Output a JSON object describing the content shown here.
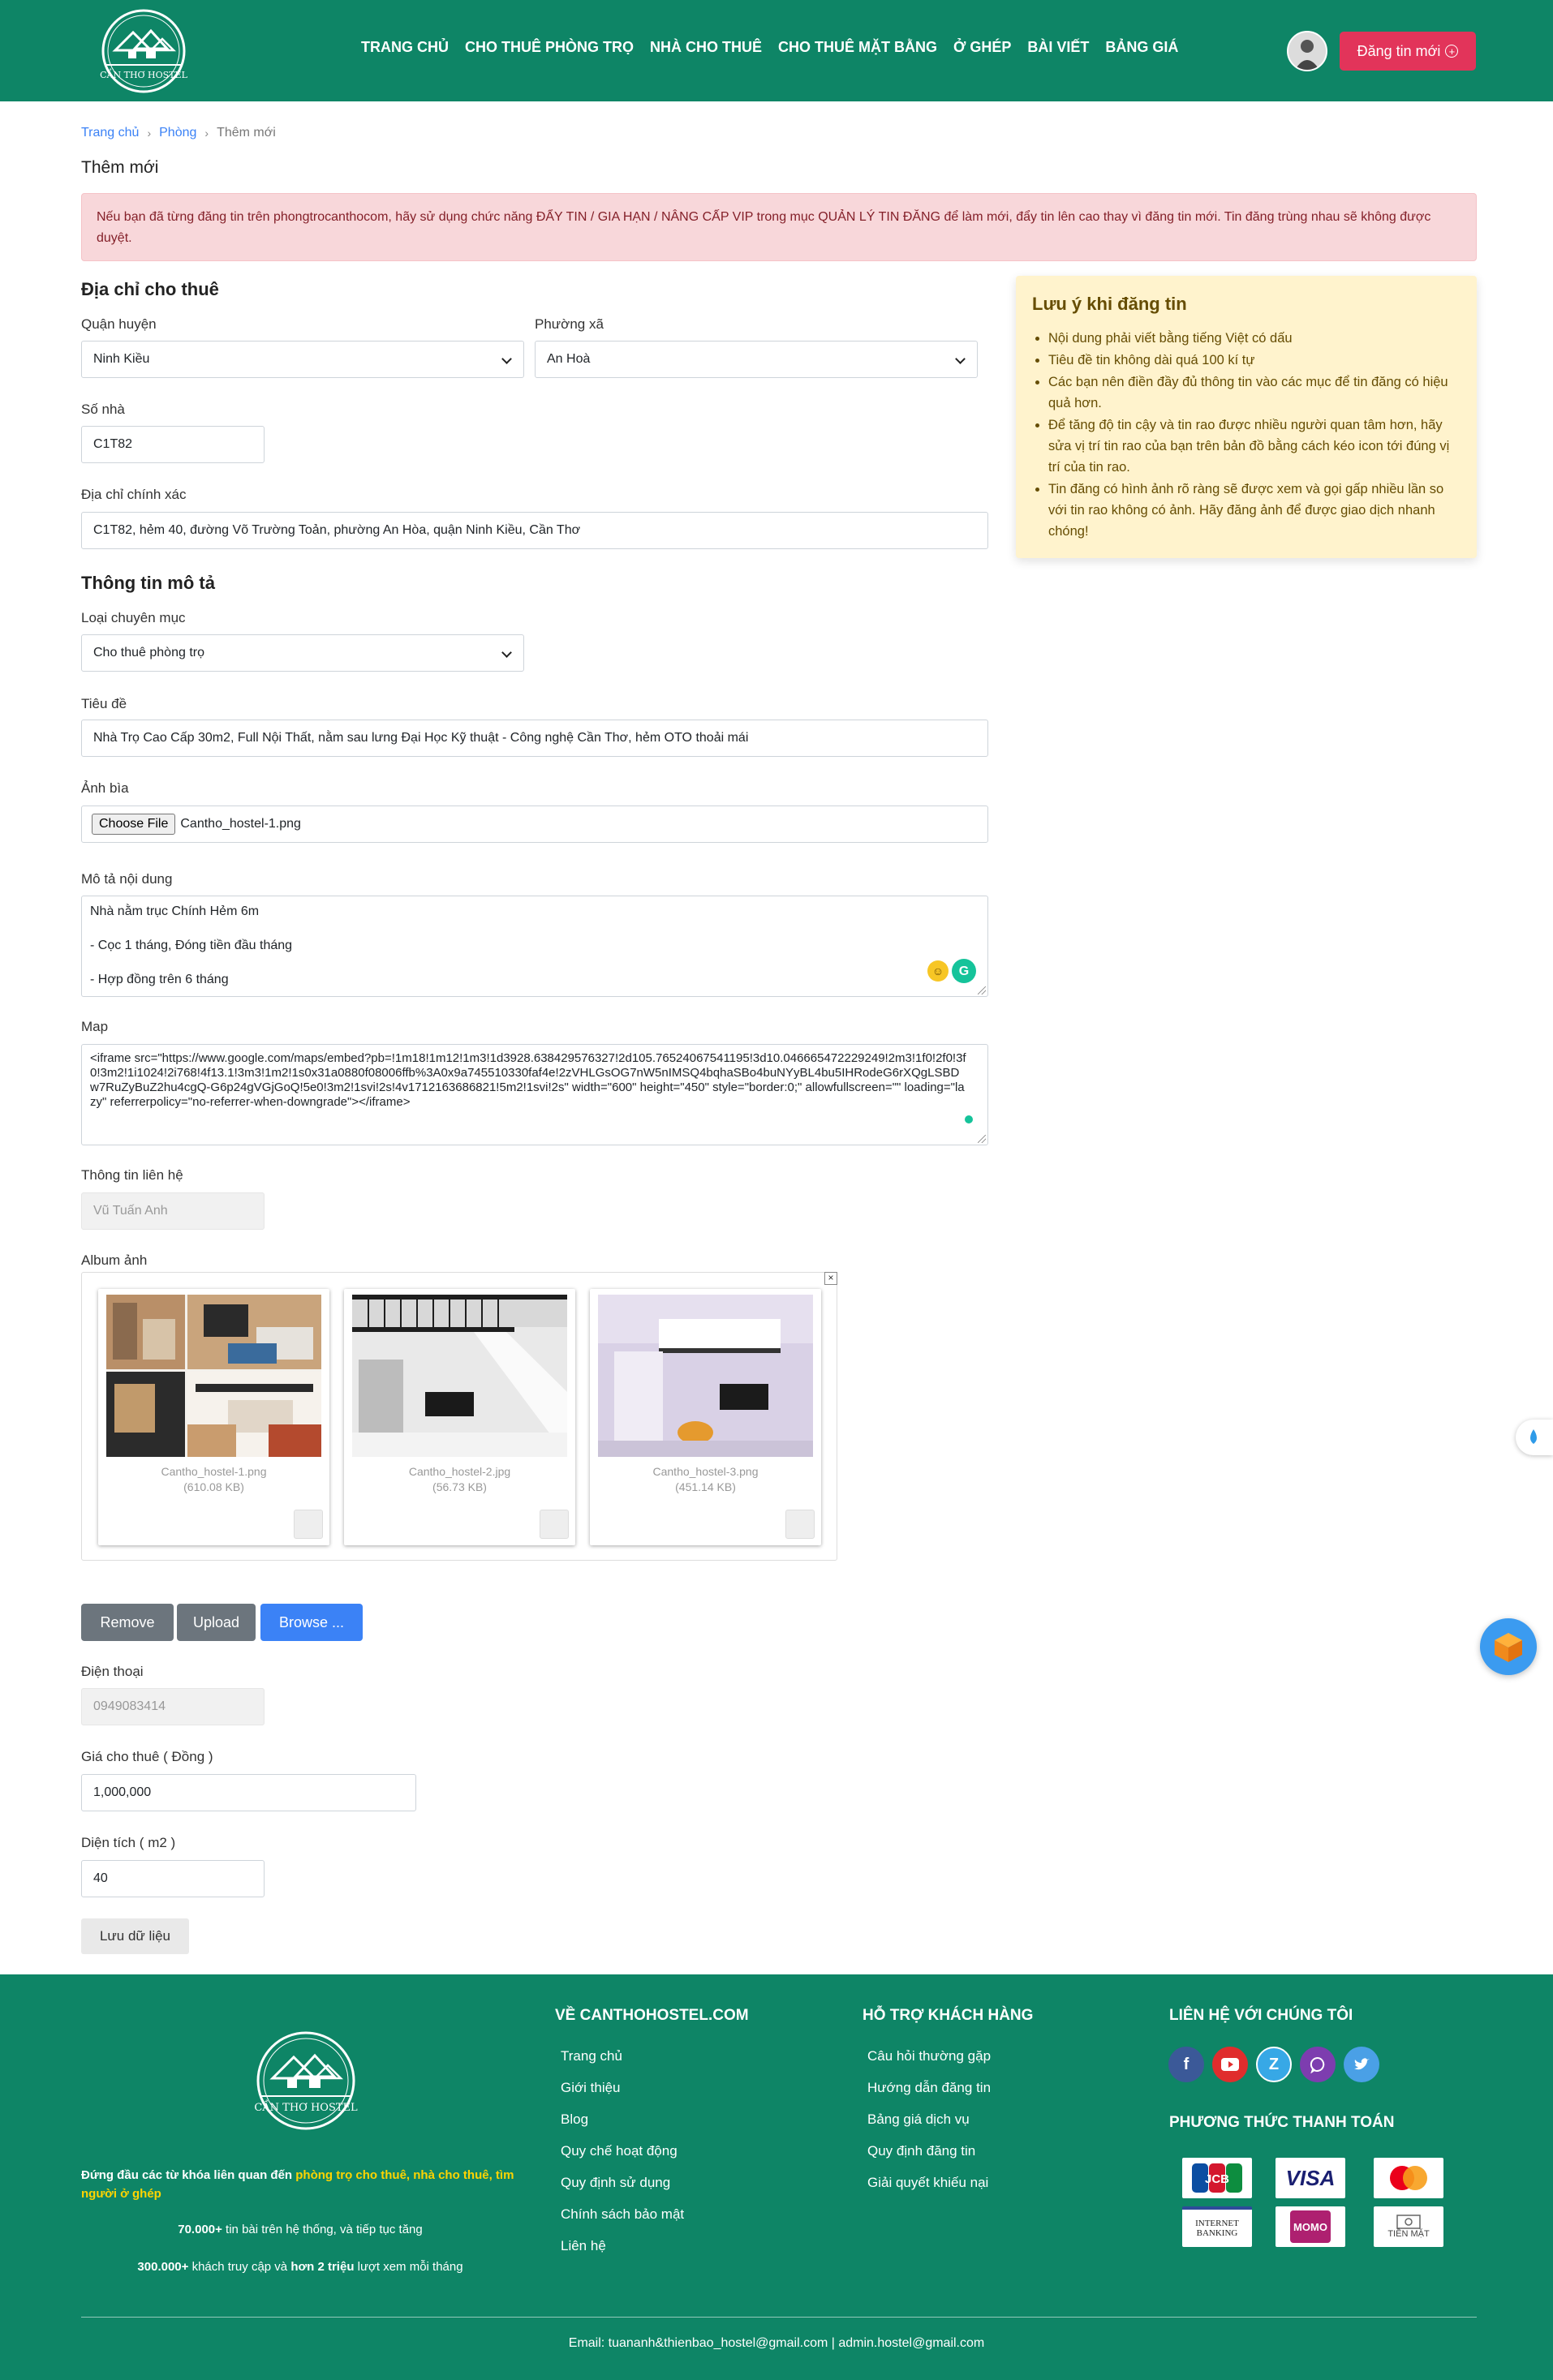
{
  "header": {
    "logo_text": "CẦN THƠ HOSTEL",
    "nav": [
      "TRANG CHỦ",
      "CHO THUÊ PHÒNG TRỌ",
      "NHÀ CHO THUÊ",
      "CHO THUÊ MẶT BẰNG",
      "Ở GHÉP",
      "BÀI VIẾT",
      "BẢNG GIÁ"
    ],
    "post_button": "Đăng tin mới"
  },
  "breadcrumb": {
    "home": "Trang chủ",
    "rooms": "Phòng",
    "current": "Thêm mới"
  },
  "page_title": "Thêm mới",
  "alert": "Nếu bạn đã từng đăng tin trên phongtrocanthocom, hãy sử dụng chức năng ĐẨY TIN / GIA HẠN / NÂNG CẤP VIP trong mục QUẢN LÝ TIN ĐĂNG để làm mới, đẩy tin lên cao thay vì đăng tin mới. Tin đăng trùng nhau sẽ không được duyệt.",
  "address": {
    "heading": "Địa chỉ cho thuê",
    "district_label": "Quận huyện",
    "district_value": "Ninh Kiều",
    "ward_label": "Phường xã",
    "ward_value": "An Hoà",
    "house_label": "Số nhà",
    "house_value": "C1T82",
    "exact_label": "Địa chỉ chính xác",
    "exact_value": "C1T82, hẻm 40, đường Võ Trường Toản, phường An Hòa, quận Ninh Kiều, Cần Thơ"
  },
  "description": {
    "heading": "Thông tin mô tả",
    "category_label": "Loại chuyên mục",
    "category_value": "Cho thuê phòng trọ",
    "title_label": "Tiêu đề",
    "title_value": "Nhà Trọ Cao Cấp 30m2, Full Nội Thất, nằm sau lưng Đại Học Kỹ thuật - Công nghệ Cần Thơ, hẻm OTO thoải mái",
    "cover_label": "Ảnh bìa",
    "choose_file": "Choose File",
    "cover_file": "Cantho_hostel-1.png",
    "content_label": "Mô tả nội dung",
    "content_lines": [
      "Nhà nằm trục Chính Hẻm 6m",
      "- Cọc 1 tháng, Đóng tiền đầu tháng",
      "- Hợp đồng trên 6 tháng"
    ],
    "map_label": "Map",
    "map_value": "<iframe src=\"https://www.google.com/maps/embed?pb=!1m18!1m12!1m3!1d3928.638429576327!2d105.76524067541195!3d10.046665472229249!2m3!1f0!2f0!3f0!3m2!1i1024!2i768!4f13.1!3m3!1m2!1s0x31a0880f08006ffb%3A0x9a745510330faf4e!2zVHLGsOG7nW5nIMSQ4bqhaSBo4buNYyBL4bu5IHRodeG6rXQgLSBDw7RuZyBuZ2hu4cgQ-G6p24gVGjGoQ!5e0!3m2!1svi!2s!4v1712163686821!5m2!1svi!2s\" width=\"600\" height=\"450\" style=\"border:0;\" allowfullscreen=\"\" loading=\"lazy\" referrerpolicy=\"no-referrer-when-downgrade\"></iframe>",
    "contact_label": "Thông tin liên hệ",
    "contact_placeholder": "Vũ Tuấn Anh",
    "album_label": "Album ảnh",
    "album": [
      {
        "name": "Cantho_hostel-1.png",
        "size": "(610.08 KB)"
      },
      {
        "name": "Cantho_hostel-2.jpg",
        "size": "(56.73 KB)"
      },
      {
        "name": "Cantho_hostel-3.png",
        "size": "(451.14 KB)"
      }
    ],
    "remove_btn": "Remove",
    "upload_btn": "Upload",
    "browse_btn": "Browse ...",
    "phone_label": "Điện thoại",
    "phone_placeholder": "0949083414",
    "price_label": "Giá cho thuê ( Đồng )",
    "price_value": "1,000,000",
    "area_label": "Diện tích ( m2 )",
    "area_value": "40",
    "save_btn": "Lưu dữ liệu"
  },
  "note": {
    "title": "Lưu ý khi đăng tin",
    "items": [
      "Nội dung phải viết bằng tiếng Việt có dấu",
      "Tiêu đề tin không dài quá 100 kí tự",
      "Các bạn nên điền đầy đủ thông tin vào các mục để tin đăng có hiệu quả hơn.",
      "Để tăng độ tin cậy và tin rao được nhiều người quan tâm hơn, hãy sửa vị trí tin rao của bạn trên bản đồ bằng cách kéo icon tới đúng vị trí của tin rao.",
      "Tin đăng có hình ảnh rõ ràng sẽ được xem và gọi gấp nhiều lần so với tin rao không có ảnh. Hãy đăng ảnh để được giao dịch nhanh chóng!"
    ]
  },
  "footer": {
    "logo_text": "CẦN THƠ HOSTEL",
    "tagline_plain": "Đứng đầu các từ khóa liên quan đến ",
    "tagline_highlight": "phòng trọ cho thuê, nhà cho thuê, tìm người ở ghép",
    "stat1_bold": "70.000+",
    "stat1_text": " tin bài trên hệ thống, và tiếp tục tăng",
    "stat2_bold": "300.000+",
    "stat2_text1": " khách truy cập và ",
    "stat2_bold2": "hơn 2 triệu",
    "stat2_text2": " lượt xem mỗi tháng",
    "about_heading": "VỀ CANTHOHOSTEL.COM",
    "about_links": [
      "Trang chủ",
      "Giới thiệu",
      "Blog",
      "Quy chế hoạt động",
      "Quy định sử dụng",
      "Chính sách bảo mật",
      "Liên hệ"
    ],
    "support_heading": "HỖ TRỢ KHÁCH HÀNG",
    "support_links": [
      "Câu hỏi thường gặp",
      "Hướng dẫn đăng tin",
      "Bảng giá dịch vụ",
      "Quy định đăng tin",
      "Giải quyết khiếu nại"
    ],
    "contact_heading": "LIÊN HỆ VỚI CHÚNG TÔI",
    "payment_heading": "PHƯƠNG THỨC THANH TOÁN",
    "payments": [
      "JCB",
      "VISA",
      "MASTERCARD",
      "INTERNET BANKING",
      "MOMO",
      "TIỀN MẶT"
    ],
    "email": "Email: tuananh&thienbao_hostel@gmail.com | admin.hostel@gmail.com"
  },
  "colors": {
    "brand_green": "#0e8566",
    "accent_red": "#e2345a",
    "link_blue": "#3b82f6"
  }
}
